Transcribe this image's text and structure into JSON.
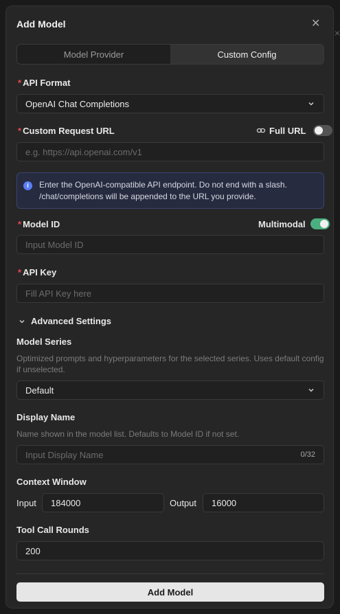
{
  "modal": {
    "title": "Add Model"
  },
  "tabs": [
    {
      "label": "Model Provider",
      "active": false
    },
    {
      "label": "Custom Config",
      "active": true
    }
  ],
  "api_format": {
    "label": "API Format",
    "value": "OpenAI Chat Completions"
  },
  "custom_url": {
    "label": "Custom Request URL",
    "full_url_label": "Full URL",
    "full_url_on": false,
    "placeholder": "e.g. https://api.openai.com/v1"
  },
  "info": {
    "text": "Enter the OpenAI-compatible API endpoint. Do not end with a slash. /chat/completions will be appended to the URL you provide."
  },
  "model_id": {
    "label": "Model ID",
    "multimodal_label": "Multimodal",
    "multimodal_on": true,
    "placeholder": "Input Model ID"
  },
  "api_key": {
    "label": "API Key",
    "placeholder": "Fill API Key here"
  },
  "advanced": {
    "label": "Advanced Settings"
  },
  "model_series": {
    "label": "Model Series",
    "help": "Optimized prompts and hyperparameters for the selected series. Uses default config if unselected.",
    "value": "Default"
  },
  "display_name": {
    "label": "Display Name",
    "help": "Name shown in the model list. Defaults to Model ID if not set.",
    "placeholder": "Input Display Name",
    "counter": "0/32"
  },
  "context_window": {
    "label": "Context Window",
    "input_label": "Input",
    "input_value": "184000",
    "output_label": "Output",
    "output_value": "16000"
  },
  "tool_call_rounds": {
    "label": "Tool Call Rounds",
    "value": "200"
  },
  "submit_label": "Add Model",
  "colors": {
    "accent_toggle": "#4caf80",
    "required": "#e5484d",
    "info_bg": "#262b40",
    "info_icon": "#5a7ef5"
  }
}
